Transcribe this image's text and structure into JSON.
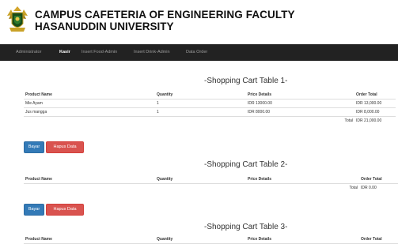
{
  "header": {
    "title_line1": "CAMPUS CAFETERIA OF ENGINEERING FACULTY",
    "title_line2": "HASANUDDIN UNIVERSITY",
    "logo_icon": "university-crest-icon",
    "logo_color": "#1a4d1a"
  },
  "nav": {
    "items": [
      "Administrator",
      "Kasir",
      "Insert Food-Admin",
      "Insert Drink-Admin",
      "Data Order"
    ],
    "active": "Kasir"
  },
  "tables": [
    {
      "title": "-Shopping Cart Table 1-",
      "headers": [
        "Product Name",
        "Quantity",
        "Price Details",
        "Order Total"
      ],
      "rows": [
        [
          "Mie Ayam",
          "1",
          "IDR 13000.00",
          "IDR 13,000.00"
        ],
        [
          "Jus mangga",
          "1",
          "IDR 8000.00",
          "IDR 8,000.00"
        ]
      ],
      "total_label": "Total",
      "total_value": "IDR 21,000.00"
    },
    {
      "title": "-Shopping Cart Table 2-",
      "headers": [
        "Product Name",
        "Quantity",
        "Price Details",
        "Order Total"
      ],
      "rows": [],
      "total_label": "Total",
      "total_value": "IDR 0.00"
    },
    {
      "title": "-Shopping Cart Table 3-",
      "headers": [
        "Product Name",
        "Quantity",
        "Price Details",
        "Order Total"
      ],
      "rows": []
    }
  ],
  "buttons": {
    "pay_label": "Bayar",
    "delete_label": "Hapus Data",
    "pay_color": "#337ab7",
    "delete_color": "#d9534f"
  },
  "colors": {
    "navbar": "#222222",
    "nav_text": "#9d9d9d",
    "nav_active": "#ffffff"
  }
}
